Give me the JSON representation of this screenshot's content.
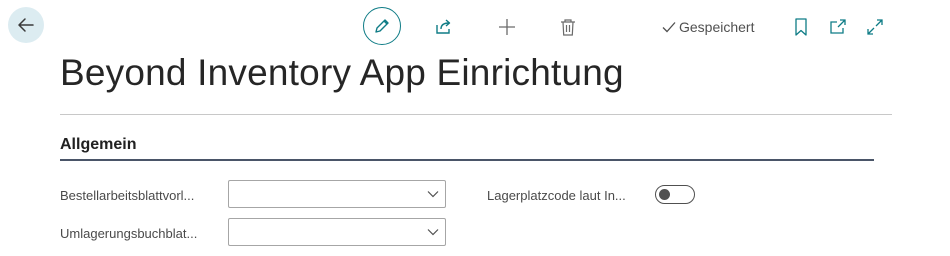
{
  "header": {
    "back_icon": "arrow-left-icon",
    "actions": {
      "edit_icon": "pencil-icon",
      "share_icon": "share-icon",
      "new_icon": "plus-icon",
      "delete_icon": "trash-icon"
    },
    "status_label": "Gespeichert",
    "status_icon": "checkmark-icon",
    "right_icons": [
      "bookmark-icon",
      "open-new-window-icon",
      "expand-icon"
    ],
    "accent_color": "#0f7c86"
  },
  "page": {
    "title": "Beyond Inventory App Einrichtung"
  },
  "section": {
    "title": "Allgemein",
    "fields": [
      {
        "label": "Bestellarbeitsblattvorl...",
        "type": "select",
        "value": ""
      },
      {
        "label": "Umlagerungsbuchblat...",
        "type": "select",
        "value": ""
      },
      {
        "label": "Lagerplatzcode laut In...",
        "type": "toggle",
        "value": false
      }
    ]
  }
}
